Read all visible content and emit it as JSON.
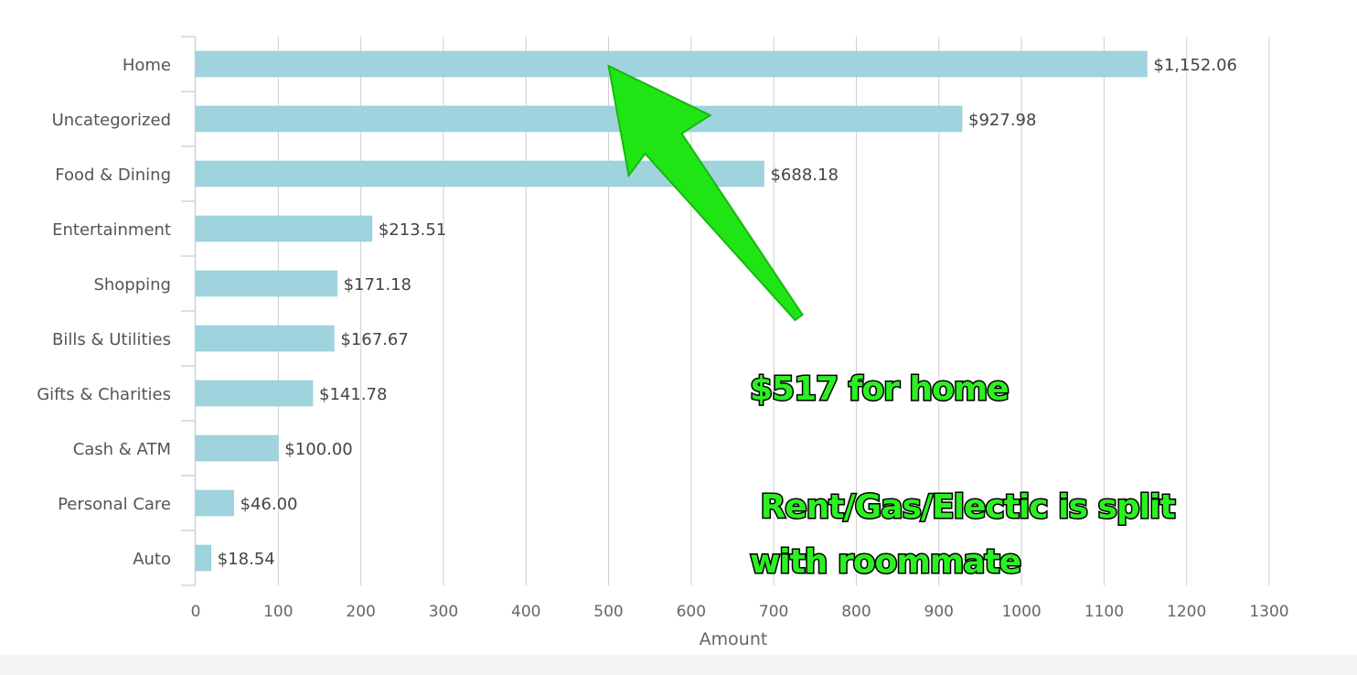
{
  "colors": {
    "bar": "#9fd4de",
    "bar_stroke": "#8cc7d2",
    "grid": "#cfcfcf",
    "axis": "#c5d7e6",
    "annotation_fill": "#2bf021",
    "annotation_stroke": "#000000"
  },
  "chart_data": {
    "type": "bar",
    "orientation": "horizontal",
    "categories": [
      "Home",
      "Uncategorized",
      "Food & Dining",
      "Entertainment",
      "Shopping",
      "Bills & Utilities",
      "Gifts & Charities",
      "Cash & ATM",
      "Personal Care",
      "Auto"
    ],
    "values": [
      1152.06,
      927.98,
      688.18,
      213.51,
      171.18,
      167.67,
      141.78,
      100.0,
      46.0,
      18.54
    ],
    "data_labels": [
      "$1,152.06",
      "$927.98",
      "$688.18",
      "$213.51",
      "$171.18",
      "$167.67",
      "$141.78",
      "$100.00",
      "$46.00",
      "$18.54"
    ],
    "xlabel": "Amount",
    "xlim": [
      0,
      1300
    ],
    "xticks": [
      0,
      100,
      200,
      300,
      400,
      500,
      600,
      700,
      800,
      900,
      1000,
      1100,
      1200,
      1300
    ],
    "xtick_labels": [
      "0",
      "100",
      "200",
      "300",
      "400",
      "500",
      "600",
      "700",
      "800",
      "900",
      "1000",
      "1100",
      "1200",
      "1300"
    ],
    "grid": true,
    "legend": "none"
  },
  "annotation": {
    "arrow_target": {
      "category": "Home",
      "x": 500
    },
    "line1": "$517 for home",
    "line2": " Rent/Gas/Electic is split",
    "line3": "with roommate"
  }
}
